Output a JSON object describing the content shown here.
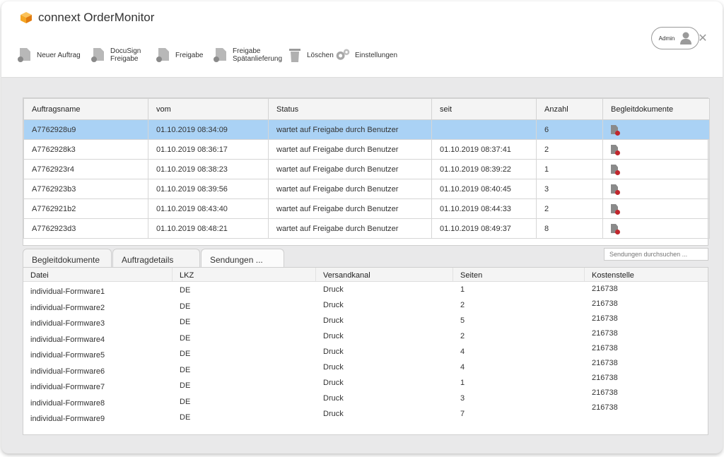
{
  "app": {
    "title": "connext OrderMonitor"
  },
  "window_controls": {
    "minimize": "—",
    "maximize": "☐",
    "close": "✕"
  },
  "toolbar": {
    "items": [
      {
        "label": "Neuer Auftrag",
        "icon": "new-order-icon"
      },
      {
        "label": "DocuSign\nFreigabe",
        "icon": "docusign-icon"
      },
      {
        "label": "Freigabe",
        "icon": "release-icon"
      },
      {
        "label": "Freigabe\nSpätanlieferung",
        "icon": "late-release-icon"
      },
      {
        "label": "Löschen",
        "icon": "trash-icon"
      },
      {
        "label": "Einstellungen",
        "icon": "gear-icon"
      }
    ],
    "user_label": "Admin"
  },
  "orders": {
    "columns": [
      "Auftragsname",
      "vom",
      "Status",
      "seit",
      "Anzahl",
      "Begleitdokumente"
    ],
    "rows": [
      {
        "name": "A7762928u9",
        "vom": "01.10.2019 08:34:09",
        "status": "wartet auf Freigabe durch Benutzer",
        "seit": "",
        "anzahl": "6"
      },
      {
        "name": "A7762928k3",
        "vom": "01.10.2019 08:36:17",
        "status": "wartet auf Freigabe durch Benutzer",
        "seit": "01.10.2019 08:37:41",
        "anzahl": "2"
      },
      {
        "name": "A7762923r4",
        "vom": "01.10.2019 08:38:23",
        "status": "wartet auf Freigabe durch Benutzer",
        "seit": "01.10.2019 08:39:22",
        "anzahl": "1"
      },
      {
        "name": "A7762923b3",
        "vom": "01.10.2019 08:39:56",
        "status": "wartet auf Freigabe durch Benutzer",
        "seit": "01.10.2019 08:40:45",
        "anzahl": "3"
      },
      {
        "name": "A7762921b2",
        "vom": "01.10.2019 08:43:40",
        "status": "wartet auf Freigabe durch Benutzer",
        "seit": "01.10.2019 08:44:33",
        "anzahl": "2"
      },
      {
        "name": "A7762923d3",
        "vom": "01.10.2019 08:48:21",
        "status": "wartet auf Freigabe durch Benutzer",
        "seit": "01.10.2019 08:49:37",
        "anzahl": "8"
      }
    ],
    "selected_row": 0
  },
  "tabs": [
    {
      "label": "Begleitdokumente"
    },
    {
      "label": "Auftragdetails"
    },
    {
      "label": "Sendungen ..."
    }
  ],
  "active_tab": 2,
  "search": {
    "placeholder": "Sendungen durchsuchen ..."
  },
  "shipments": {
    "columns": [
      "Datei",
      "LKZ",
      "Versandkanal",
      "Seiten",
      "Kostenstelle"
    ],
    "rows": [
      {
        "datei": "individual-Formware1",
        "lkz": "DE",
        "kanal": "Druck",
        "seiten": "1",
        "kst": "216738"
      },
      {
        "datei": "individual-Formware2",
        "lkz": "DE",
        "kanal": "Druck",
        "seiten": "2",
        "kst": "216738"
      },
      {
        "datei": "individual-Formware3",
        "lkz": "DE",
        "kanal": "Druck",
        "seiten": "5",
        "kst": "216738"
      },
      {
        "datei": "individual-Formware4",
        "lkz": "DE",
        "kanal": "Druck",
        "seiten": "2",
        "kst": "216738"
      },
      {
        "datei": "individual-Formware5",
        "lkz": "DE",
        "kanal": "Druck",
        "seiten": "4",
        "kst": "216738"
      },
      {
        "datei": "individual-Formware6",
        "lkz": "DE",
        "kanal": "Druck",
        "seiten": "4",
        "kst": "216738"
      },
      {
        "datei": "individual-Formware7",
        "lkz": "DE",
        "kanal": "Druck",
        "seiten": "1",
        "kst": "216738"
      },
      {
        "datei": "individual-Formware8",
        "lkz": "DE",
        "kanal": "Druck",
        "seiten": "3",
        "kst": "216738"
      },
      {
        "datei": "individual-Formware9",
        "lkz": "DE",
        "kanal": "Druck",
        "seiten": "7",
        "kst": "216738"
      }
    ]
  },
  "colors": {
    "selection": "#aad2f5",
    "brand_orange": "#f5a623",
    "badge_red": "#c0272d"
  }
}
